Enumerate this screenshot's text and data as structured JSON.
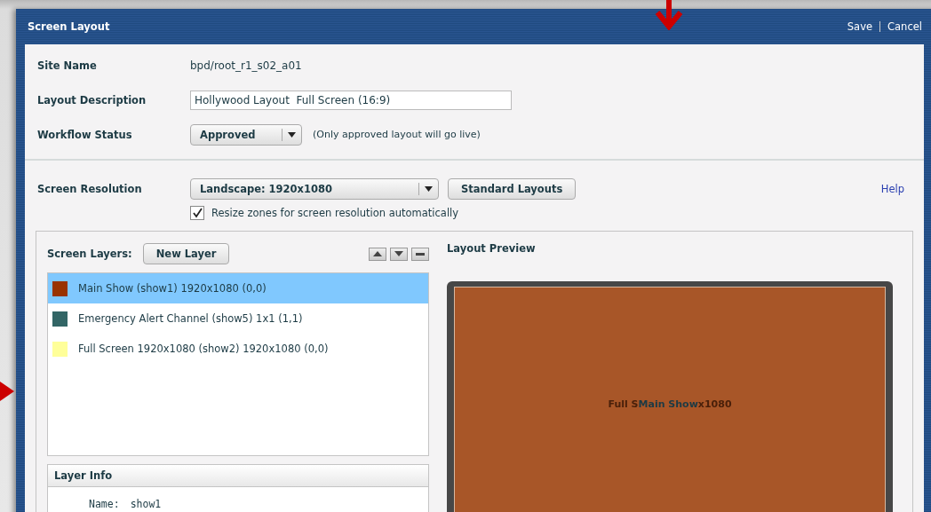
{
  "window": {
    "title": "Screen Layout",
    "actions": [
      "Save",
      "Cancel"
    ]
  },
  "site": {
    "label": "Site Name",
    "value": "bpd/root_r1_s02_a01"
  },
  "description": {
    "label": "Layout Description",
    "value": "Hollywood Layout  Full Screen (16:9)"
  },
  "workflow": {
    "label": "Workflow Status",
    "value": "Approved",
    "note": "(Only approved layout will go live)"
  },
  "resolution": {
    "label": "Screen Resolution",
    "value": "Landscape: 1920x1080",
    "standard_button": "Standard Layouts",
    "help": "Help",
    "auto_resize": {
      "label": "Resize zones for screen resolution automatically",
      "checked": true
    }
  },
  "layers": {
    "label": "Screen Layers:",
    "new_button": "New Layer",
    "items": [
      {
        "label": "Main Show (show1) 1920x1080 (0,0)",
        "color": "#993300",
        "selected": true
      },
      {
        "label": "Emergency Alert Channel (show5) 1x1 (1,1)",
        "color": "#336666",
        "selected": false
      },
      {
        "label": "Full Screen 1920x1080 (show2) 1920x1080 (0,0)",
        "color": "#ffff99",
        "selected": false
      }
    ]
  },
  "layer_info": {
    "title": "Layer Info",
    "name_label": "Name:",
    "name_value": "show1"
  },
  "preview": {
    "title": "Layout Preview",
    "back_zone_parts": [
      "Full S",
      "x1080"
    ],
    "front_zone": "Main Show"
  }
}
